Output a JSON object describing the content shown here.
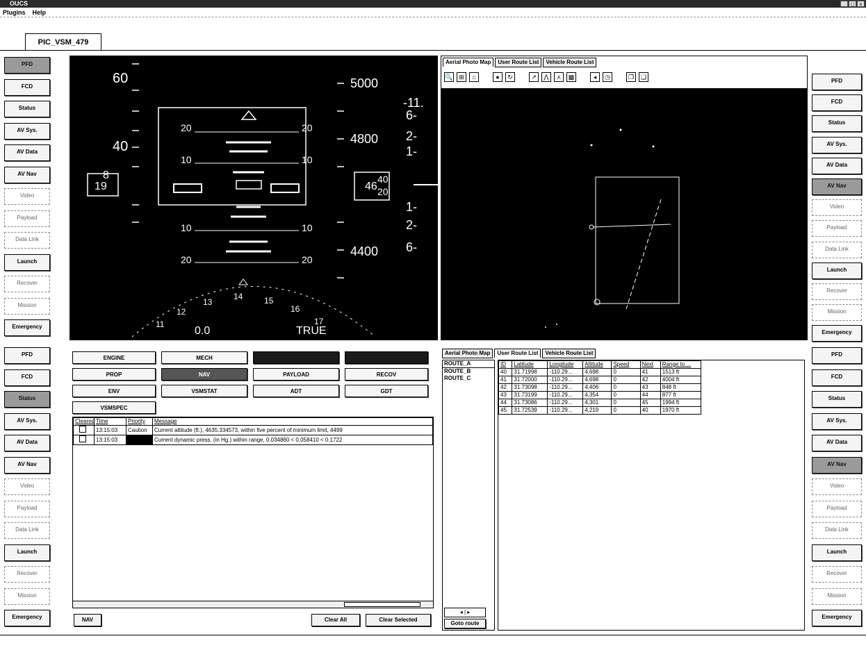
{
  "window": {
    "title": "OUCS"
  },
  "menu": [
    "Plugins",
    "Help"
  ],
  "vehicle_tab": "PIC_VSM_479",
  "left_sidebar_top": [
    "PFD",
    "FCD",
    "Status",
    "AV Sys.",
    "AV Data",
    "AV Nav",
    "Video",
    "Payload",
    "Data Link",
    "Launch",
    "Recover",
    "Mission",
    "Emergency"
  ],
  "left_sidebar_bottom": [
    "PFD",
    "FCD",
    "Status",
    "AV Sys.",
    "AV Data",
    "AV Nav",
    "Video",
    "Payload",
    "Data Link",
    "Launch",
    "Recover",
    "Mission",
    "Emergency"
  ],
  "right_sidebar_top": [
    "PFD",
    "FCD",
    "Status",
    "AV Sys.",
    "AV Data",
    "AV Nav",
    "Video",
    "Payload",
    "Data Link",
    "Launch",
    "Recover",
    "Mission",
    "Emergency"
  ],
  "right_sidebar_bottom": [
    "PFD",
    "FCD",
    "Status",
    "AV Sys.",
    "AV Data",
    "AV Nav",
    "Video",
    "Payload",
    "Data Link",
    "Launch",
    "Recover",
    "Mission",
    "Emergency"
  ],
  "pfd": {
    "speed_ticks": [
      "60",
      "40"
    ],
    "speed_box": [
      "8",
      "19"
    ],
    "alt_ticks": [
      "5000",
      "4800",
      "4400"
    ],
    "alt_box": "46",
    "alt_box_digits": [
      "40",
      "20"
    ],
    "vs_ticks": [
      "-11.",
      "6-",
      "2-",
      "1-",
      "1-",
      "2-",
      "6-"
    ],
    "pitch_left": [
      "20",
      "10",
      "10",
      "20"
    ],
    "pitch_right": [
      "20",
      "10",
      "10",
      "20"
    ],
    "heading_ticks": [
      "11",
      "12",
      "13",
      "14",
      "15",
      "16",
      "17"
    ],
    "heading_value": "0.0",
    "heading_ref": "TRUE"
  },
  "map_panel": {
    "tabs": [
      "Aerial Photo Map",
      "User Route List",
      "Vehicle Route List"
    ]
  },
  "route_panel": {
    "tabs": [
      "Aerial Photo Map",
      "User Route List",
      "Vehicle Route List"
    ],
    "routes": [
      "ROUTE_A",
      "ROUTE_B",
      "ROUTE_C"
    ],
    "goto_label": "Goto route",
    "columns": [
      "ID",
      "Latitude",
      "Longitude",
      "Altitude",
      "Speed",
      "Next",
      "Range to ..."
    ],
    "rows": [
      [
        "40",
        "31.71998",
        "-110.29...",
        "4,698",
        "0",
        "41",
        "1513 ft"
      ],
      [
        "41",
        "31.72000",
        "-110.29...",
        "4,698",
        "0",
        "42",
        "4004 ft"
      ],
      [
        "42",
        "31.73098",
        "-110.29...",
        "4,406",
        "0",
        "43",
        "848 ft"
      ],
      [
        "43",
        "31.73199",
        "-110.29...",
        "4,354",
        "0",
        "44",
        "877 ft"
      ],
      [
        "44",
        "31.73086",
        "-110.29...",
        "4,301",
        "0",
        "45",
        "1994 ft"
      ],
      [
        "45",
        "31.72539",
        "-110.29...",
        "4,219",
        "0",
        "40",
        "1970 ft"
      ]
    ]
  },
  "caution_panel": {
    "buttons": [
      "ENGINE",
      "MECH",
      "",
      "",
      "PROP",
      "NAV",
      "PAYLOAD",
      "RECOV",
      "ENV",
      "VSMSTAT",
      "ADT",
      "GDT",
      "VSMSPEC"
    ],
    "columns": [
      "Cleared",
      "Time",
      "Priority",
      "Message"
    ],
    "rows": [
      {
        "time": "13:15:03",
        "priority": "Caution",
        "message": "Current altitude (ft.), 4635.334573, within five percent of minimum limit, 4499"
      },
      {
        "time": "13:15:03",
        "priority": "",
        "message": "Current dynamic press. (in Hg.) within range, 0.034860 < 0.058410 < 0.1722"
      }
    ],
    "footer_left": "NAV",
    "clear_all": "Clear All",
    "clear_selected": "Clear Selected"
  }
}
